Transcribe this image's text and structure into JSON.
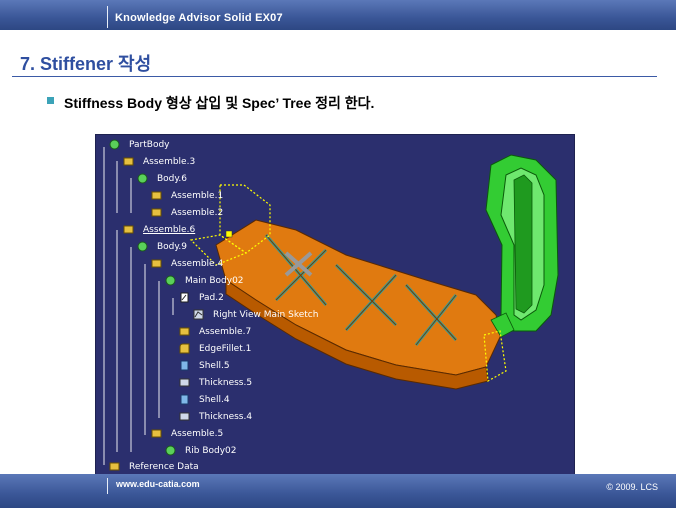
{
  "header": {
    "product": "Knowledge Advisor Solid EX07"
  },
  "slide": {
    "title": "7. Stiffener 작성",
    "bullet": "Stiffness Body 형상 삽입 및 Spec’ Tree 정리 한다."
  },
  "tree": [
    {
      "label": "PartBody",
      "icon": "partbody-icon"
    },
    {
      "label": "Assemble.3",
      "icon": "assemble-icon"
    },
    {
      "label": "Body.6",
      "icon": "body-icon"
    },
    {
      "label": "Assemble.1",
      "icon": "assemble-icon"
    },
    {
      "label": "Assemble.2",
      "icon": "assemble-icon"
    },
    {
      "label": "Assemble.6",
      "icon": "assemble-icon"
    },
    {
      "label": "Body.9",
      "icon": "body-icon"
    },
    {
      "label": "Assemble.4",
      "icon": "assemble-icon"
    },
    {
      "label": "Main Body02",
      "icon": "body-icon"
    },
    {
      "label": "Pad.2",
      "icon": "pad-icon"
    },
    {
      "label": "Right View Main Sketch",
      "icon": "sketch-icon"
    },
    {
      "label": "Assemble.7",
      "icon": "assemble-icon"
    },
    {
      "label": "EdgeFillet.1",
      "icon": "fillet-icon"
    },
    {
      "label": "Shell.5",
      "icon": "shell-icon"
    },
    {
      "label": "Thickness.5",
      "icon": "thickness-icon"
    },
    {
      "label": "Shell.4",
      "icon": "shell-icon"
    },
    {
      "label": "Thickness.4",
      "icon": "thickness-icon"
    },
    {
      "label": "Assemble.5",
      "icon": "assemble-icon"
    },
    {
      "label": "Rib Body02",
      "icon": "body-icon"
    },
    {
      "label": "Reference Data",
      "icon": "reference-icon"
    }
  ],
  "colors": {
    "banner": "#3a5697",
    "title": "#2f4fa0",
    "bullet": "#3ca3b8",
    "viewport": "#2b2f6e",
    "part_orange": "#e07a10",
    "stiffener_green": "#33cc33",
    "selection": "#ffff00"
  },
  "footer": {
    "url": "www.edu-catia.com",
    "copyright": "© 2009. LCS"
  }
}
